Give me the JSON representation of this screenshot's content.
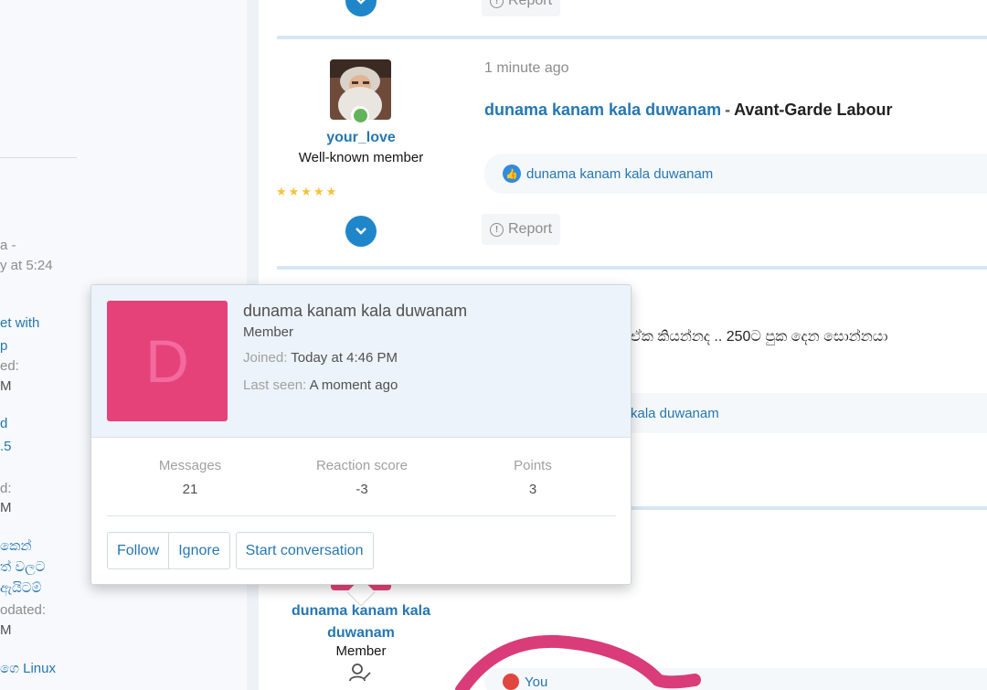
{
  "sidebar": {
    "fragments": [
      {
        "text": "a -",
        "cls": "meta"
      },
      {
        "text": "y at 5:24",
        "cls": "meta"
      },
      {
        "text": "et with",
        "cls": "link"
      },
      {
        "text": "p",
        "cls": "link"
      },
      {
        "text": "ed:",
        "cls": "meta"
      },
      {
        "text": "M",
        "cls": "dark"
      },
      {
        "text": "d",
        "cls": "link"
      },
      {
        "text": ".5",
        "cls": "link"
      },
      {
        "text": "d:",
        "cls": "meta"
      },
      {
        "text": "M",
        "cls": "dark"
      },
      {
        "text": "කෙන්",
        "cls": "link"
      },
      {
        "text": "ත් වලට",
        "cls": "link"
      },
      {
        "text": "ඇයිටම්",
        "cls": "link"
      },
      {
        "text": "odated:",
        "cls": "meta"
      },
      {
        "text": "M",
        "cls": "dark"
      },
      {
        "text": "ගෙ Linux",
        "cls": "link"
      }
    ]
  },
  "report_label": "Report",
  "post1": {
    "author": "your_love",
    "author_title": "Well-known member",
    "rating_stars": 5,
    "time": "1 minute ago",
    "title_user": "dunama kanam kala duwanam",
    "title_sep": "-",
    "title_thread": "Avant-Garde Labour",
    "reaction_user": "dunama kanam kala duwanam"
  },
  "post2": {
    "text": "ඒක කියන්නද .. 250ට පුක දෙන සොන්නයා",
    "reaction_user": "kala duwanam"
  },
  "post3": {
    "author_line1": "dunama kanam kala",
    "author_line2": "duwanam",
    "author_title": "Member",
    "reaction_user": "You"
  },
  "popup": {
    "avatar_letter": "D",
    "name": "dunama kanam kala duwanam",
    "title": "Member",
    "joined_label": "Joined:",
    "joined_value": "Today at 4:46 PM",
    "seen_label": "Last seen:",
    "seen_value": "A moment ago",
    "stats": [
      {
        "label": "Messages",
        "value": "21"
      },
      {
        "label": "Reaction score",
        "value": "-3"
      },
      {
        "label": "Points",
        "value": "3"
      }
    ],
    "buttons": {
      "follow": "Follow",
      "ignore": "Ignore",
      "conversation": "Start conversation"
    }
  },
  "colors": {
    "link": "#2577b1",
    "accent": "#1f87c9",
    "avatar_bg": "#e6427a",
    "annotation": "#d93c78"
  },
  "icons": {
    "online": "online-status-icon",
    "expand": "chevron-down-icon",
    "report": "report-icon",
    "like": "like-icon",
    "love": "heart-icon",
    "member_edit": "user-edit-icon"
  }
}
